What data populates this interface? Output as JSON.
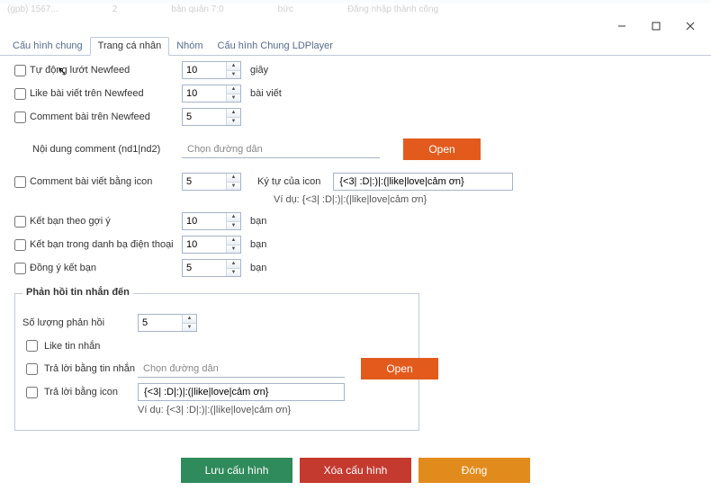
{
  "faint": {
    "a": "(gpb) 1567...",
    "b": "2",
    "c": "bản quản 7:0",
    "d": "bức",
    "e": "Đăng nhập thành công"
  },
  "tabs": {
    "t0": "Cấu hình chung",
    "t1": "Trang cá nhân",
    "t2": "Nhóm",
    "t3": "Cấu hình Chung LDPlayer"
  },
  "rows": {
    "autoScroll": {
      "label": "Tự động lướt Newfeed",
      "value": "10",
      "unit": "giây"
    },
    "likePost": {
      "label": "Like bài viết trên Newfeed",
      "value": "10",
      "unit": "bài viết"
    },
    "commentPost": {
      "label": "Comment bài trên Newfeed",
      "value": "5"
    },
    "commentContent": {
      "label": "Nội dung comment (nd1|nd2)",
      "placeholder": "Chọn đường dẫn",
      "open": "Open"
    },
    "commentIcon": {
      "label": "Comment bài viết bằng icon",
      "value": "5",
      "iconLabel": "Ký tự của icon",
      "iconValue": "{<3| :D|:)|:(|like|love|cảm ơn}",
      "example": "Ví dụ: {<3| :D|:)|:(|like|love|cảm ơn}"
    },
    "friendSuggest": {
      "label": "Kết bạn theo gợi ý",
      "value": "10",
      "unit": "bạn"
    },
    "friendContacts": {
      "label": "Kết bạn trong danh bạ điện thoại",
      "value": "10",
      "unit": "bạn"
    },
    "friendAccept": {
      "label": "Đồng ý kết bạn",
      "value": "5",
      "unit": "bạn"
    }
  },
  "group": {
    "title": "Phản hồi tin nhắn đến",
    "replyCount": {
      "label": "Số lượng phản hồi",
      "value": "5"
    },
    "likeMsg": {
      "label": "Like tin nhắn"
    },
    "replyMsg": {
      "label": "Trả lời bằng tin nhắn",
      "placeholder": "Chọn đường dẫn",
      "open": "Open"
    },
    "replyIcon": {
      "label": "Trả lời bằng icon",
      "value": "{<3| :D|:)|:(|like|love|cảm ơn}",
      "example": "Ví dụ: {<3| :D|:)|:(|like|love|cảm ơn}"
    }
  },
  "buttons": {
    "save": "Lưu cấu hình",
    "del": "Xóa cấu hình",
    "close": "Đóng"
  }
}
